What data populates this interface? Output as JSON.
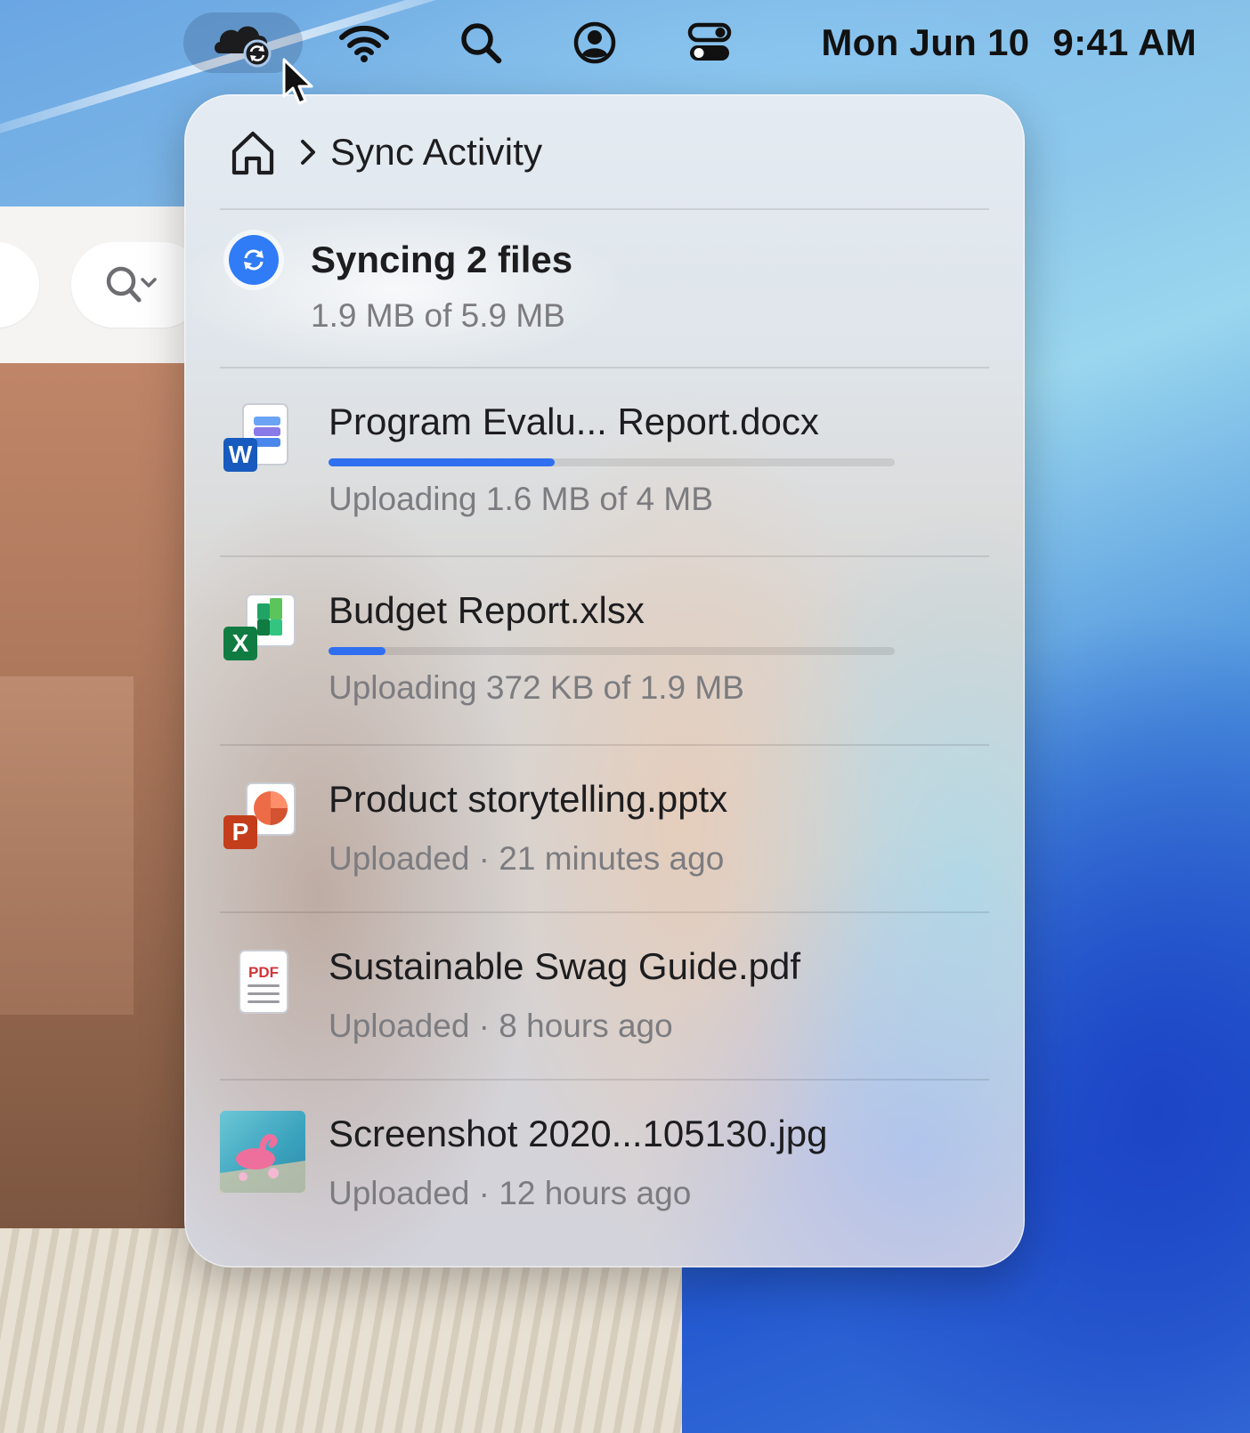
{
  "menubar": {
    "clock_date": "Mon Jun 10",
    "clock_time": "9:41 AM",
    "icons": [
      "onedrive-sync-icon",
      "wifi-icon",
      "search-icon",
      "user-account-icon",
      "control-center-icon"
    ]
  },
  "popover": {
    "breadcrumb_title": "Sync Activity",
    "summary": {
      "title": "Syncing 2 files",
      "subtitle": "1.9 MB of 5.9 MB"
    },
    "files": [
      {
        "name": "Program Evalu... Report.docx",
        "status": "Uploading 1.6 MB of 4 MB",
        "icon": "word-doc-icon",
        "progress": 0.4
      },
      {
        "name": "Budget Report.xlsx",
        "status": "Uploading 372 KB of 1.9 MB",
        "icon": "excel-sheet-icon",
        "progress": 0.1
      },
      {
        "name": "Product storytelling.pptx",
        "status": "Uploaded · 21 minutes ago",
        "icon": "powerpoint-icon"
      },
      {
        "name": "Sustainable Swag Guide.pdf",
        "status": "Uploaded · 8 hours ago",
        "icon": "pdf-file-icon"
      },
      {
        "name": "Screenshot 2020...105130.jpg",
        "status": "Uploaded · 12 hours ago",
        "icon": "image-thumbnail"
      }
    ]
  },
  "colors": {
    "accent": "#2f6ff0",
    "sync_badge": "#2f7cf6",
    "word": "#185abd",
    "excel": "#107c41",
    "powerpoint": "#c43e1c",
    "pdf": "#d13438"
  }
}
